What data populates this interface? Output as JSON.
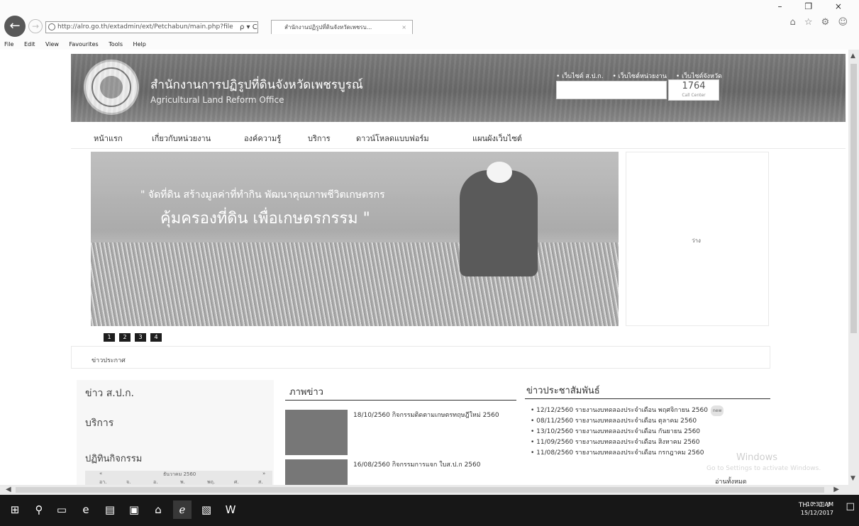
{
  "browser": {
    "url": "http://alro.go.th/extadmin/ext/Petchabun/main.php?file",
    "address_tools": "ρ ▾ C",
    "tab_title": "สำนักงานปฏิรูปที่ดินจังหวัดเพชรบ...",
    "tab_close": "×",
    "window_controls": "– ❐ ×",
    "toolbar_icons": "⌂ ☆ ⚙ ☺",
    "menu": [
      "File",
      "Edit",
      "View",
      "Favourites",
      "Tools",
      "Help"
    ]
  },
  "header": {
    "title_th": "สำนักงานการปฏิรูปที่ดินจังหวัดเพชรบูรณ์",
    "title_en": "Agricultural Land Reform Office",
    "quick_links": [
      "• เว็บไซต์ ส.ป.ก.",
      "• เว็บไซต์หน่วยงาน",
      "• เว็บไซต์จังหวัด"
    ],
    "callcenter_number": "1764",
    "callcenter_label": "Call Center"
  },
  "nav": {
    "items": [
      "หน้าแรก",
      "เกี่ยวกับหน่วยงาน",
      "องค์ความรู้",
      "บริการ",
      "ดาวน์โหลดแบบฟอร์ม",
      "แผนผังเว็บไซต์"
    ]
  },
  "slider": {
    "slogan_line1": "\" จัดที่ดิน สร้างมูลค่าที่ทำกิน พัฒนาคุณภาพชีวิตเกษตรกร",
    "slogan_line2": "คุ้มครองที่ดิน เพื่อเกษตรกรรม \"",
    "pages": [
      "1",
      "2",
      "3",
      "4"
    ]
  },
  "side_box": {
    "text": "ว่าง"
  },
  "announcement": {
    "label": "ข่าวประกาศ"
  },
  "left_column": {
    "links": [
      "ข่าว ส.ป.ก.",
      "บริการ"
    ],
    "calendar_title": "ปฏิทินกิจกรรม",
    "calendar_month": "ธันวาคม 2560",
    "calendar_days": [
      "อา.",
      "จ.",
      "อ.",
      "พ.",
      "พฤ.",
      "ศ.",
      "ส."
    ]
  },
  "news": {
    "title": "ภาพข่าว",
    "items": [
      {
        "text": "18/10/2560 กิจกรรมติดตามเกษตรทฤษฎีใหม่ 2560"
      },
      {
        "text": "16/08/2560 กิจกรรมการแจก ใบส.ป.ก 2560"
      }
    ]
  },
  "pr": {
    "title": "ข่าวประชาสัมพันธ์",
    "items": [
      "12/12/2560 รายงานงบทดลองประจำเดือน พฤศจิกายน 2560",
      "08/11/2560 รายงานงบทดลองประจำเดือน ตุลาคม 2560",
      "13/10/2560 รายงานงบทดลองประจำเดือน กันยายน 2560",
      "11/09/2560 รายงานงบทดลองประจำเดือน สิงหาคม 2560",
      "11/08/2560 รายงานงบทดลองประจำเดือน กรกฎาคม 2560"
    ],
    "new_badge": "new",
    "read_all": "อ่านทั้งหมด"
  },
  "watermark": {
    "line1": "Windows",
    "line2": "Go to Settings to activate Windows."
  },
  "taskbar": {
    "language": "TH",
    "tray_icons": "^ ☐ ♪",
    "time": "10:33 AM",
    "date": "15/12/2017"
  }
}
